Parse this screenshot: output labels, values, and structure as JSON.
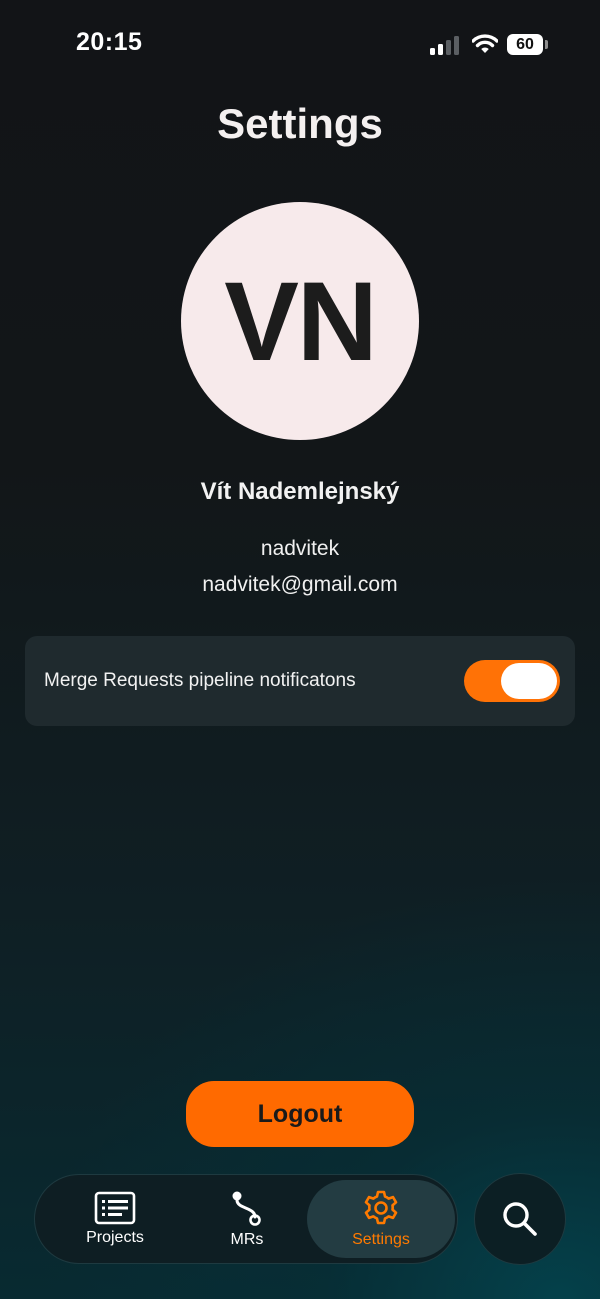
{
  "status_bar": {
    "time": "20:15",
    "battery": "60",
    "icons": [
      "cellular-signal-icon",
      "wifi-icon",
      "battery-icon"
    ]
  },
  "page": {
    "title": "Settings"
  },
  "profile": {
    "initials": "VN",
    "full_name": "Vít Nademlejnský",
    "username": "nadvitek",
    "email": "nadvitek@gmail.com"
  },
  "settings": {
    "notifications_label": "Merge Requests pipeline notificatons",
    "notifications_enabled": true
  },
  "actions": {
    "logout_label": "Logout"
  },
  "tabbar": {
    "items": [
      {
        "label": "Projects",
        "icon": "projects-list-icon",
        "active": false
      },
      {
        "label": "MRs",
        "icon": "merge-request-icon",
        "active": false
      },
      {
        "label": "Settings",
        "icon": "gear-icon",
        "active": true
      }
    ],
    "search_icon": "search-icon"
  },
  "colors": {
    "accent": "#ff6a00",
    "toggle_on": "#ff7206",
    "avatar_bg": "#f7eaeb",
    "card_bg": "#1f2a2e",
    "background_top": "#121417",
    "background_bottom": "#082a31"
  }
}
